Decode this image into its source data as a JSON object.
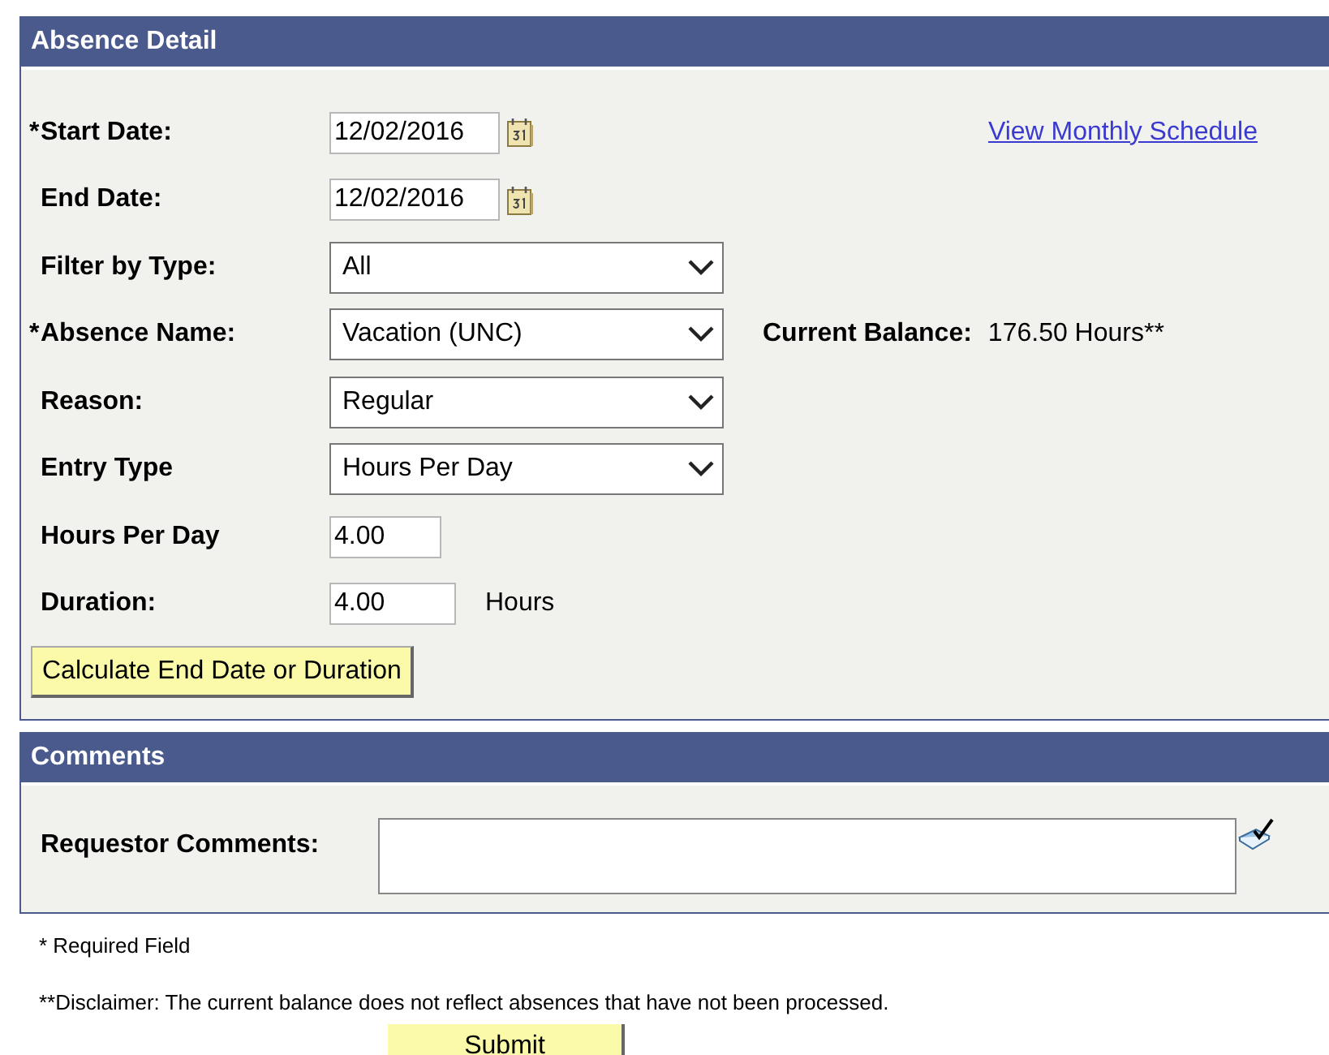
{
  "absence_detail": {
    "title": "Absence Detail",
    "fields": [
      {
        "kind": "date",
        "marker": "*",
        "label": "Start Date:",
        "value": "12/02/2016",
        "link": "View Monthly Schedule"
      },
      {
        "kind": "date",
        "label": "End Date:",
        "value": "12/02/2016"
      },
      {
        "kind": "select",
        "label": "Filter by Type:",
        "value": "All"
      },
      {
        "kind": "select",
        "marker": "*",
        "label": "Absence Name:",
        "value": "Vacation (UNC)",
        "balance_label": "Current Balance:",
        "balance_value": "176.50 Hours**"
      },
      {
        "kind": "select",
        "label": "Reason:",
        "value": "Regular"
      },
      {
        "kind": "select",
        "label": "Entry Type",
        "value": "Hours Per Day"
      },
      {
        "kind": "number",
        "label": "Hours Per Day",
        "value": "4.00"
      },
      {
        "kind": "number_wide",
        "label": "Duration:",
        "value": "4.00",
        "unit": "Hours"
      }
    ],
    "calculate_button": "Calculate End Date or Duration"
  },
  "comments": {
    "title": "Comments",
    "label": "Requestor Comments:"
  },
  "required_note": "* Required Field",
  "disclaimer": "**Disclaimer: The current balance does not reflect absences that have not been processed.",
  "submit_button": "Submit"
}
